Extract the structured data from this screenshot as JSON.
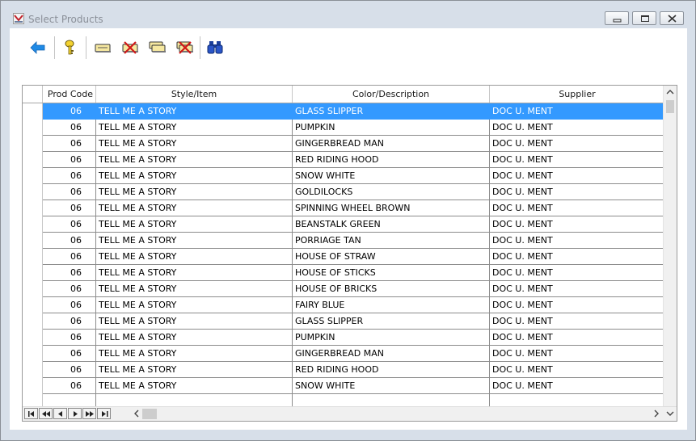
{
  "window": {
    "title": "Select Products"
  },
  "toolbar": {
    "icons": [
      "back-arrow-icon",
      "key-icon",
      "ticket-icon",
      "delete-ticket-icon",
      "ticket-stack-icon",
      "delete-ticket-stack-icon",
      "binoculars-icon"
    ]
  },
  "grid": {
    "columns": [
      "Prod Code",
      "Style/Item",
      "Color/Description",
      "Supplier"
    ],
    "selected_row": 0,
    "selection_color": "#3399ff",
    "rows": [
      [
        "06",
        "TELL ME A STORY",
        "GLASS SLIPPER",
        "DOC U. MENT"
      ],
      [
        "06",
        "TELL ME A STORY",
        "PUMPKIN",
        "DOC U. MENT"
      ],
      [
        "06",
        "TELL ME A STORY",
        "GINGERBREAD MAN",
        "DOC U. MENT"
      ],
      [
        "06",
        "TELL ME A STORY",
        "RED RIDING HOOD",
        "DOC U. MENT"
      ],
      [
        "06",
        "TELL ME A STORY",
        "SNOW WHITE",
        "DOC U. MENT"
      ],
      [
        "06",
        "TELL ME A STORY",
        "GOLDILOCKS",
        "DOC U. MENT"
      ],
      [
        "06",
        "TELL ME A STORY",
        "SPINNING WHEEL BROWN",
        "DOC U. MENT"
      ],
      [
        "06",
        "TELL ME A STORY",
        "BEANSTALK GREEN",
        "DOC U. MENT"
      ],
      [
        "06",
        "TELL ME A STORY",
        "PORRIAGE TAN",
        "DOC U. MENT"
      ],
      [
        "06",
        "TELL ME A STORY",
        "HOUSE OF STRAW",
        "DOC U. MENT"
      ],
      [
        "06",
        "TELL ME A STORY",
        "HOUSE OF STICKS",
        "DOC U. MENT"
      ],
      [
        "06",
        "TELL ME A STORY",
        "HOUSE OF BRICKS",
        "DOC U. MENT"
      ],
      [
        "06",
        "TELL ME A STORY",
        "FAIRY BLUE",
        "DOC U. MENT"
      ],
      [
        "06",
        "TELL ME A STORY",
        "GLASS SLIPPER",
        "DOC U. MENT"
      ],
      [
        "06",
        "TELL ME A STORY",
        "PUMPKIN",
        "DOC U. MENT"
      ],
      [
        "06",
        "TELL ME A STORY",
        "GINGERBREAD MAN",
        "DOC U. MENT"
      ],
      [
        "06",
        "TELL ME A STORY",
        "RED RIDING HOOD",
        "DOC U. MENT"
      ],
      [
        "06",
        "TELL ME A STORY",
        "SNOW WHITE",
        "DOC U. MENT"
      ]
    ]
  }
}
